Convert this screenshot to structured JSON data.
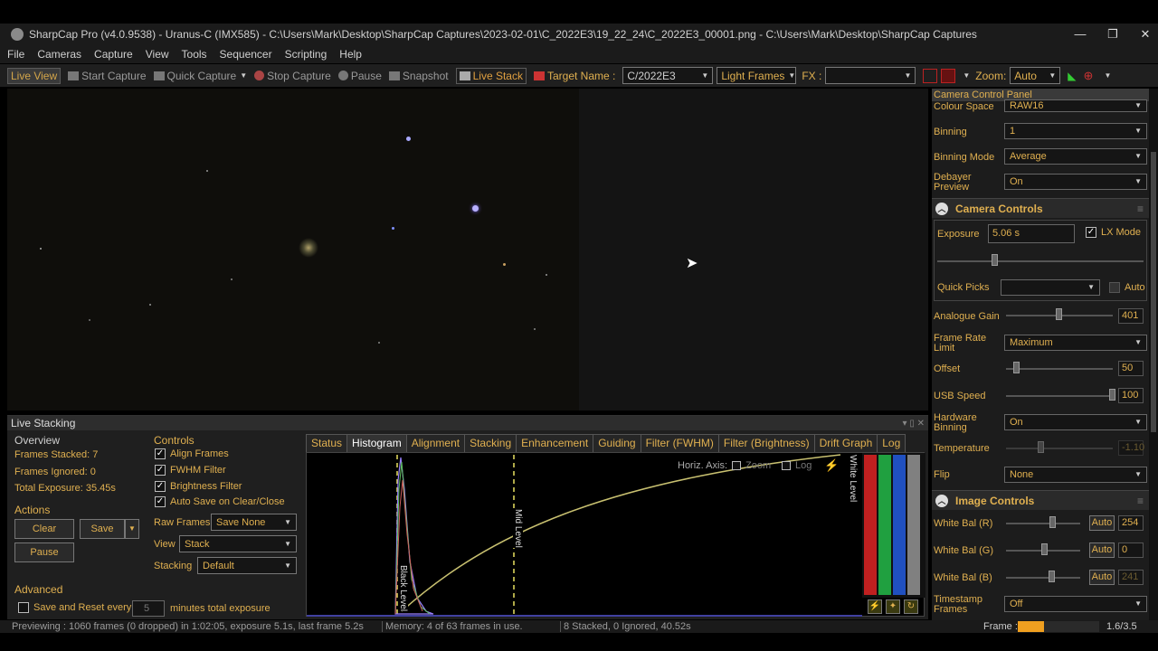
{
  "window": {
    "title": "SharpCap Pro (v4.0.9538) - Uranus-C (IMX585) - C:\\Users\\Mark\\Desktop\\SharpCap Captures\\2023-02-01\\C_2022E3\\19_22_24\\C_2022E3_00001.png - C:\\Users\\Mark\\Desktop\\SharpCap Captures",
    "minimize": "—",
    "maximize": "❐",
    "close": "✕"
  },
  "menu": [
    "File",
    "Cameras",
    "Capture",
    "View",
    "Tools",
    "Sequencer",
    "Scripting",
    "Help"
  ],
  "toolbar": {
    "live_view": "Live View",
    "start_capture": "Start Capture",
    "quick_capture": "Quick Capture",
    "stop_capture": "Stop Capture",
    "pause": "Pause",
    "snapshot": "Snapshot",
    "live_stack": "Live Stack",
    "target_label": "Target Name :",
    "target_value": "C/2022E3",
    "frame_type": "Light Frames",
    "fx_label": "FX :",
    "fx_value": "",
    "zoom_label": "Zoom:",
    "zoom_value": "Auto"
  },
  "live_stacking": {
    "title": "Live Stacking",
    "overview": {
      "title": "Overview",
      "frames_stacked": "Frames Stacked: 7",
      "frames_ignored": "Frames Ignored: 0",
      "total_exposure": "Total Exposure:  35.45s"
    },
    "actions": {
      "title": "Actions",
      "clear": "Clear",
      "save": "Save",
      "pause": "Pause"
    },
    "advanced": {
      "title": "Advanced",
      "save_reset_label": "Save and Reset every",
      "save_reset_value": "5",
      "minutes_label": "minutes total exposure"
    },
    "controls": {
      "title": "Controls",
      "align": "Align Frames",
      "fwhm": "FWHM Filter",
      "brightness": "Brightness Filter",
      "autosave": "Auto Save on Clear/Close",
      "raw_frames_label": "Raw Frames",
      "raw_frames_value": "Save None",
      "view_label": "View",
      "view_value": "Stack",
      "stacking_label": "Stacking",
      "stacking_value": "Default"
    },
    "tabs": [
      "Status",
      "Histogram",
      "Alignment",
      "Stacking",
      "Enhancement",
      "Guiding",
      "Filter (FWHM)",
      "Filter (Brightness)",
      "Drift Graph",
      "Log"
    ],
    "histogram": {
      "horiz_axis": "Horiz. Axis:",
      "zoom": "Zoom",
      "log": "Log",
      "black_level": "Black Level",
      "mid_level": "Mid Level",
      "white_level": "White Level"
    }
  },
  "status_bar": {
    "previewing": "Previewing : 1060 frames (0 dropped) in 1:02:05, exposure 5.1s, last frame 5.2s",
    "memory": "Memory: 4 of 63 frames in use.",
    "stacked": "8 Stacked, 0 Ignored, 40.52s",
    "frame_label": "Frame :",
    "frame_progress": "1.6/3.5"
  },
  "camera_panel": {
    "title": "Camera Control Panel",
    "colour_space_label": "Colour Space",
    "colour_space": "RAW16",
    "binning_label": "Binning",
    "binning": "1",
    "binning_mode_label": "Binning Mode",
    "binning_mode": "Average",
    "debayer_label": "Debayer Preview",
    "debayer": "On",
    "camera_controls": "Camera Controls",
    "exposure_label": "Exposure",
    "exposure": "5.06 s",
    "lx_mode": "LX Mode",
    "quick_picks": "Quick Picks",
    "auto": "Auto",
    "gain_label": "Analogue Gain",
    "gain": "401",
    "frame_rate_label": "Frame Rate Limit",
    "frame_rate": "Maximum",
    "offset_label": "Offset",
    "offset": "50",
    "usb_label": "USB Speed",
    "usb": "100",
    "hw_binning_label": "Hardware Binning",
    "hw_binning": "On",
    "temperature_label": "Temperature",
    "temperature": "-1.10",
    "flip_label": "Flip",
    "flip": "None",
    "image_controls": "Image Controls",
    "wb_r_label": "White Bal (R)",
    "wb_r": "254",
    "wb_g_label": "White Bal (G)",
    "wb_g": "0",
    "wb_b_label": "White Bal (B)",
    "wb_b": "241",
    "auto_btn": "Auto",
    "timestamp_label": "Timestamp Frames",
    "timestamp": "Off"
  },
  "colors": {
    "accent": "#e0b050",
    "frame_bar": "#f0a020"
  }
}
